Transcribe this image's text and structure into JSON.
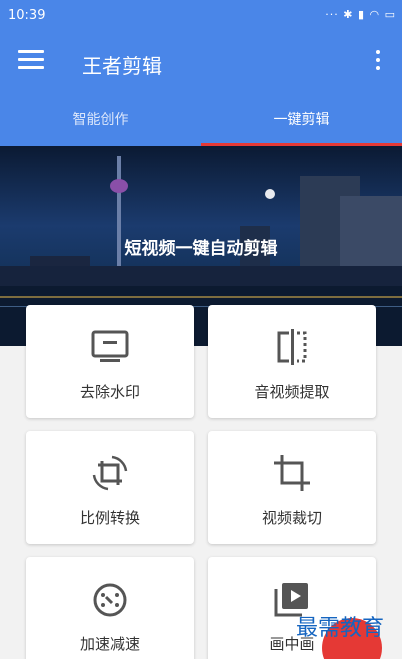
{
  "status_bar": {
    "time": "10:39",
    "icons": "··· ✱ ▮ ◠ ▭"
  },
  "app_bar": {
    "title": "王者剪辑"
  },
  "tabs": [
    {
      "label": "智能创作",
      "selected": false
    },
    {
      "label": "一键剪辑",
      "selected": true
    }
  ],
  "banner": {
    "text": "短视频一键自动剪辑"
  },
  "features": [
    {
      "label": "去除水印",
      "icon": "monitor-icon"
    },
    {
      "label": "音视频提取",
      "icon": "split-icon"
    },
    {
      "label": "比例转换",
      "icon": "rotate-crop-icon"
    },
    {
      "label": "视频裁切",
      "icon": "crop-icon"
    },
    {
      "label": "加速减速",
      "icon": "speed-icon"
    },
    {
      "label": "画中画",
      "icon": "video-library-icon"
    }
  ],
  "watermark": "最需教育",
  "colors": {
    "primary": "#4a86e8",
    "accent": "#e53935",
    "icon": "#555555"
  }
}
